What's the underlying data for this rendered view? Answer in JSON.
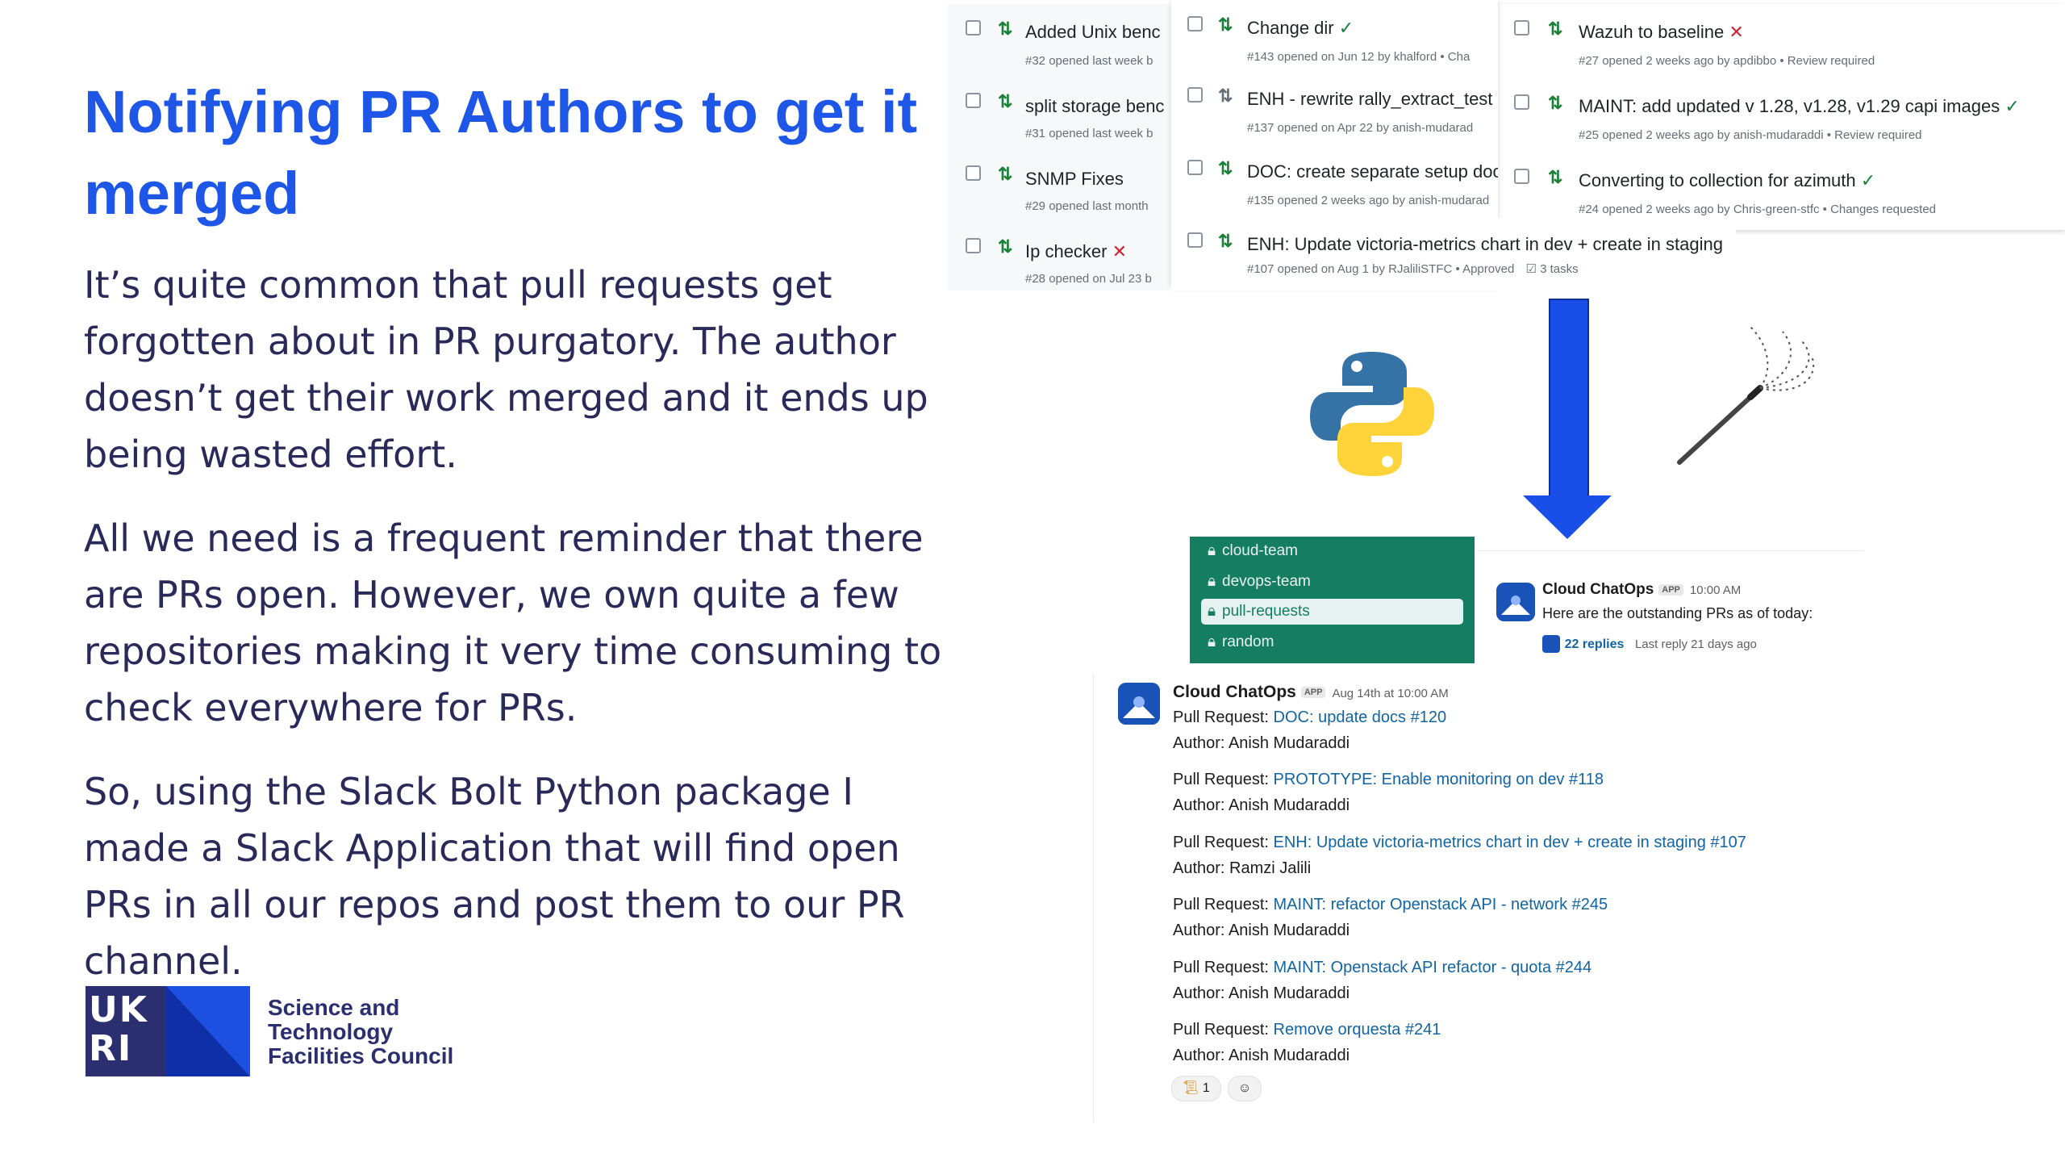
{
  "slide": {
    "title": "Notifying PR Authors to get it merged",
    "paragraphs": [
      "It’s quite common that pull requests get forgotten about in PR purgatory. The author doesn’t get their work merged and it ends up being wasted effort.",
      "All we need is a frequent reminder that there are PRs open. However, we own quite a few repositories making it very time consuming to check everywhere for PRs.",
      "So, using the Slack Bolt Python package I made a Slack Application that will find open PRs in all our repos and post them to our PR channel."
    ],
    "logo": {
      "letters_top": "UK",
      "letters_bottom": "RI",
      "text_lines": [
        "Science and",
        "Technology",
        "Facilities Council"
      ]
    }
  },
  "github": {
    "panel1": [
      {
        "title": "Added Unix benc",
        "meta": "#32 opened last week b",
        "status": ""
      },
      {
        "title": "split storage benc",
        "meta": "#31 opened last week b",
        "status": ""
      },
      {
        "title": "SNMP Fixes",
        "meta": "#29 opened last month",
        "status": ""
      },
      {
        "title": "Ip checker",
        "meta": "#28 opened on Jul 23 b",
        "status": "✕"
      }
    ],
    "panel2": [
      {
        "title": "Change dir",
        "meta": "#143 opened on Jun 12 by khalford • Cha",
        "status": "✓"
      },
      {
        "title": "ENH - rewrite rally_extract_test",
        "meta": "#137 opened on Apr 22 by anish-mudarad",
        "status": ""
      },
      {
        "title": "DOC: create separate setup docs",
        "meta": "#135 opened 2 weeks ago by anish-mudarad",
        "status": ""
      },
      {
        "title": "ENH: Update victoria-metrics chart in dev + create in staging",
        "meta": "#107 opened on Aug 1 by RJaliliSTFC • Approved",
        "tasks": "3 tasks",
        "status": ""
      }
    ],
    "panel3": [
      {
        "title": "Wazuh to baseline",
        "meta": "#27 opened 2 weeks ago by apdibbo • Review required",
        "status": "✕"
      },
      {
        "title": "MAINT: add updated v 1.28, v1.28, v1.29 capi images",
        "meta": "#25 opened 2 weeks ago by anish-mudaraddi • Review required",
        "status": "✓"
      },
      {
        "title": "Converting to collection for azimuth",
        "meta": "#24 opened 2 weeks ago by Chris-green-stfc • Changes requested",
        "status": "✓"
      }
    ]
  },
  "slack": {
    "channels": [
      "cloud-team",
      "devops-team",
      "pull-requests",
      "random"
    ],
    "active_channel": "pull-requests",
    "thread_msg": {
      "sender": "Cloud ChatOps",
      "tag": "APP",
      "time": "10:00 AM",
      "text": "Here are the outstanding PRs as of today:",
      "replies": "22 replies",
      "last_reply": "Last reply 21 days ago"
    },
    "main_msg": {
      "sender": "Cloud ChatOps",
      "tag": "APP",
      "time": "Aug 14th at 10:00 AM",
      "pr_prefix": "Pull Request: ",
      "author_prefix": "Author: ",
      "items": [
        {
          "link": "DOC: update docs #120",
          "author": "Anish Mudaraddi"
        },
        {
          "link": "PROTOTYPE: Enable monitoring on dev #118",
          "author": "Anish Mudaraddi"
        },
        {
          "link": "ENH: Update victoria-metrics chart in dev + create in staging #107",
          "author": "Ramzi Jalili"
        },
        {
          "link": "MAINT: refactor Openstack API - network #245",
          "author": "Anish Mudaraddi"
        },
        {
          "link": "MAINT: Openstack API refactor - quota #244",
          "author": "Anish Mudaraddi"
        },
        {
          "link": "Remove orquesta #241",
          "author": "Anish Mudaraddi"
        }
      ],
      "reaction_count": "1"
    }
  },
  "colors": {
    "title_blue": "#1e56e8",
    "arrow_blue": "#1a4ee8",
    "slack_green": "#157d62",
    "link_blue": "#1264a3"
  }
}
